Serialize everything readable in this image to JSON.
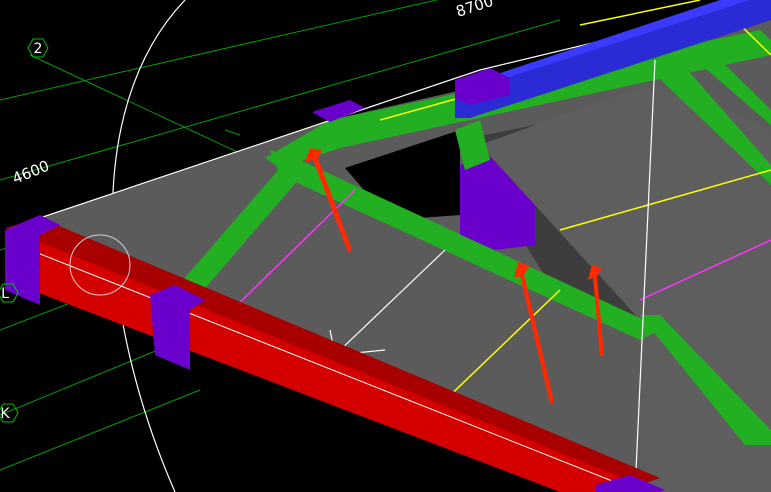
{
  "viewport": {
    "background": "#000000"
  },
  "axes": {
    "items": [
      {
        "label": "2"
      },
      {
        "label": "K"
      },
      {
        "label": "L"
      }
    ]
  },
  "dimensions": {
    "items": [
      {
        "label": "4600"
      },
      {
        "label": "8700"
      }
    ]
  },
  "colors": {
    "slab": "#5b5b5b",
    "beam_red": "#d40000",
    "beam_green": "#22b022",
    "column_purple": "#6a00cc",
    "beam_blue": "#2b2bd6",
    "grid_green": "#00a000",
    "annotation_arrow": "#ff2a00",
    "magenta_line": "#ff33ff",
    "yellow_line": "#ffff00"
  },
  "annotations": {
    "arrow_count": 3
  }
}
